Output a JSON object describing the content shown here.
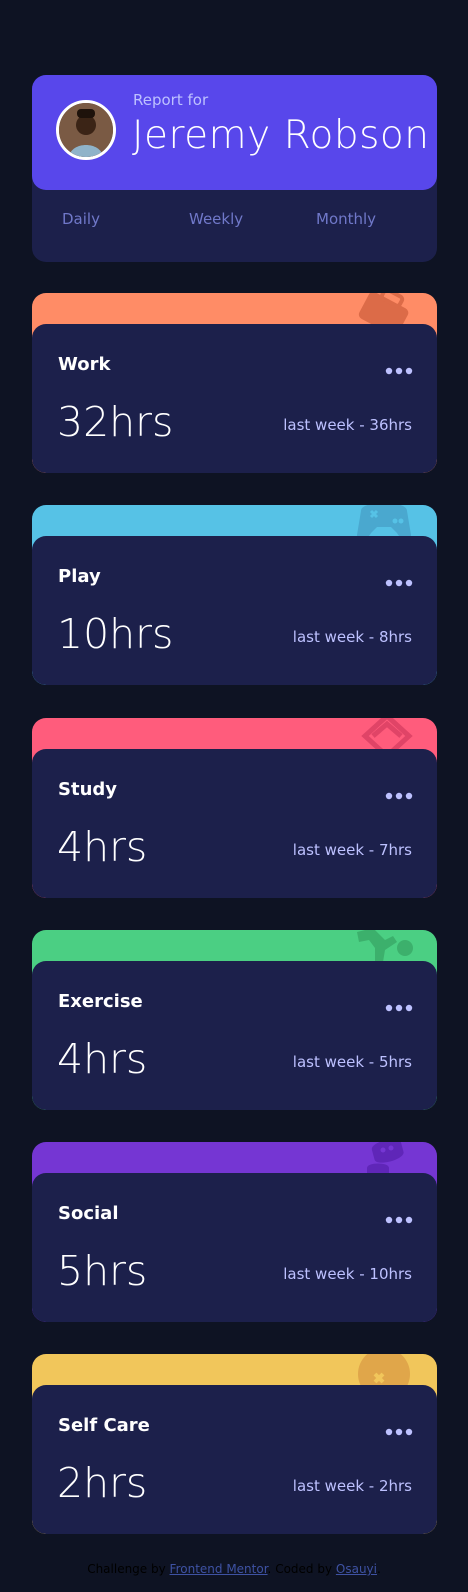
{
  "profile": {
    "report_for": "Report for",
    "name": "Jeremy Robson",
    "tabs": [
      "Daily",
      "Weekly",
      "Monthly"
    ]
  },
  "cards": [
    {
      "title": "Work",
      "current": "32hrs",
      "previous": "last week -  36hrs",
      "color": "#ff8c66",
      "icon": "work-icon"
    },
    {
      "title": "Play",
      "current": "10hrs",
      "previous": "last week -  8hrs",
      "color": "#56c2e6",
      "icon": "play-icon"
    },
    {
      "title": "Study",
      "current": "4hrs",
      "previous": "last week -  7hrs",
      "color": "#ff5c7c",
      "icon": "study-icon"
    },
    {
      "title": "Exercise",
      "current": "4hrs",
      "previous": "last week -  5hrs",
      "color": "#4bcf83",
      "icon": "exercise-icon"
    },
    {
      "title": "Social",
      "current": "5hrs",
      "previous": "last week -  10hrs",
      "color": "#7536d3",
      "icon": "social-icon"
    },
    {
      "title": "Self Care",
      "current": "2hrs",
      "previous": "last week -  2hrs",
      "color": "#f1c65b",
      "icon": "self-care-icon"
    }
  ],
  "footer": {
    "challenge_by": "Challenge by",
    "frontend_mentor": "Frontend Mentor",
    "coded_by": "Coded by",
    "author": "Osauyi"
  }
}
